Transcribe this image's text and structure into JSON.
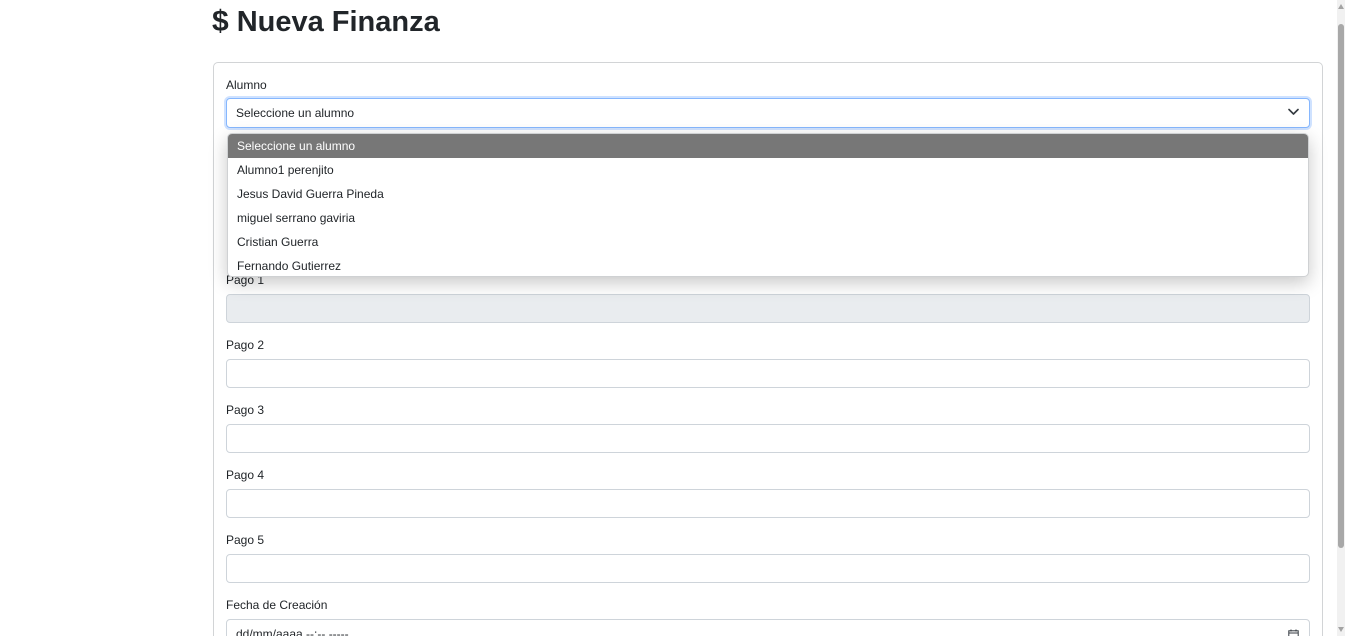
{
  "page": {
    "title_icon": "$",
    "title": "Nueva Finanza"
  },
  "form": {
    "student": {
      "label": "Alumno",
      "selected": "Seleccione un alumno",
      "options": [
        "Seleccione un alumno",
        "Alumno1 perenjito",
        "Jesus David Guerra Pineda",
        "miguel serrano gaviria",
        "Cristian Guerra",
        "Fernando Gutierrez"
      ]
    },
    "payment1": {
      "label": "Pago 1",
      "value": ""
    },
    "payment2": {
      "label": "Pago 2",
      "value": ""
    },
    "payment3": {
      "label": "Pago 3",
      "value": ""
    },
    "payment4": {
      "label": "Pago 4",
      "value": ""
    },
    "payment5": {
      "label": "Pago 5",
      "value": ""
    },
    "created_date": {
      "label": "Fecha de Creación",
      "placeholder": "dd/mm/aaaa --:-- -----"
    }
  },
  "icons": {
    "title": "dollar-icon",
    "select": "chevron-down-icon",
    "date": "calendar-icon"
  },
  "colors": {
    "focus_border": "#86b7fe",
    "selected_option_bg": "#777777",
    "disabled_input_bg": "#e9ecef"
  }
}
